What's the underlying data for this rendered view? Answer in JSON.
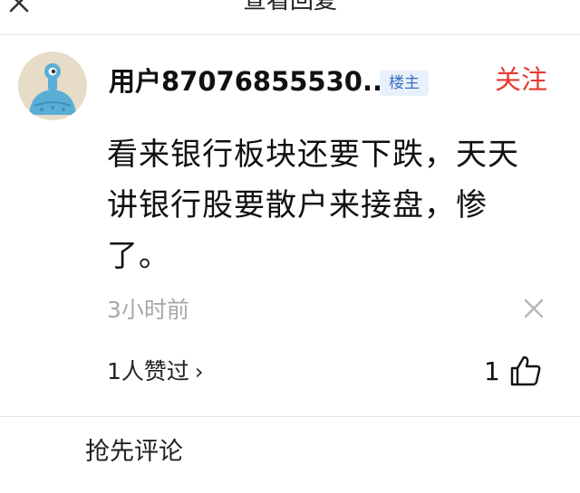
{
  "header": {
    "title": "查看回复"
  },
  "post": {
    "username": "用户87076855530...",
    "op_badge": "楼主",
    "follow_label": "关注",
    "content": "看来银行板块还要下跌，天天讲银行股要散户来接盘，惨了。",
    "time": "3小时前",
    "likes_text": "1人赞过",
    "likes_chevron": "›",
    "like_count": "1"
  },
  "footer": {
    "comment_prompt": "抢先评论"
  },
  "colors": {
    "follow": "#e8392f",
    "badge_bg": "#e8f0fb",
    "badge_text": "#3b6fc4",
    "muted": "#a8a8a8",
    "avatar_bg": "#e7dcc7",
    "avatar_figure": "#5aaed6"
  },
  "icons": {
    "close": "close-icon",
    "dismiss": "dismiss-icon",
    "like": "thumbs-up-icon",
    "avatar": "robot-avatar"
  }
}
